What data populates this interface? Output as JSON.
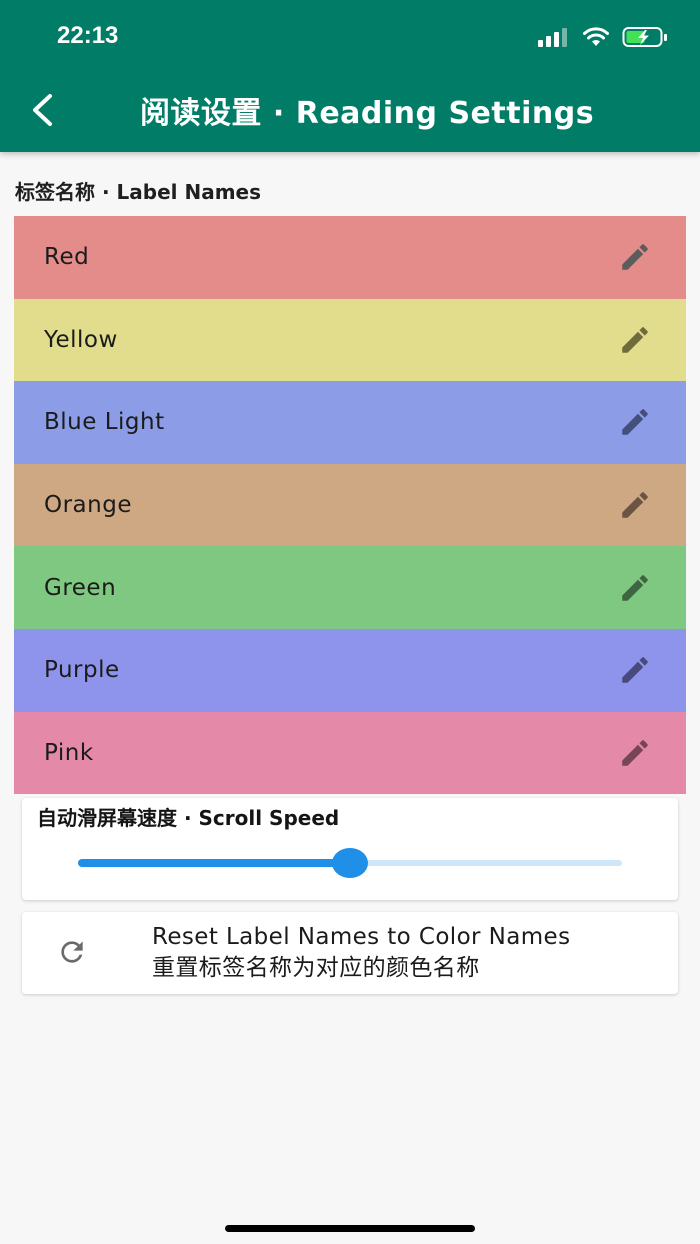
{
  "status_bar": {
    "time": "22:13"
  },
  "app_bar": {
    "title": "阅读设置 · Reading Settings"
  },
  "labels_section": {
    "title": "标签名称 · Label Names",
    "items": [
      {
        "label": "Red",
        "color": "#e38c89"
      },
      {
        "label": "Yellow",
        "color": "#e1dd8d"
      },
      {
        "label": "Blue Light",
        "color": "#8c9ce6"
      },
      {
        "label": "Orange",
        "color": "#cea883"
      },
      {
        "label": "Green",
        "color": "#7fc881"
      },
      {
        "label": "Purple",
        "color": "#8e93ec"
      },
      {
        "label": "Pink",
        "color": "#e48aa8"
      }
    ]
  },
  "scroll_speed": {
    "title": "自动滑屏幕速度 · Scroll Speed",
    "value_fraction": 0.5
  },
  "reset": {
    "line1": "Reset Label Names to Color Names",
    "line2": "重置标签名称为对应的颜色名称"
  },
  "colors": {
    "app_bar": "#017d67",
    "accent": "#1f8fe8",
    "edit_icon": "#5c5c5c"
  }
}
